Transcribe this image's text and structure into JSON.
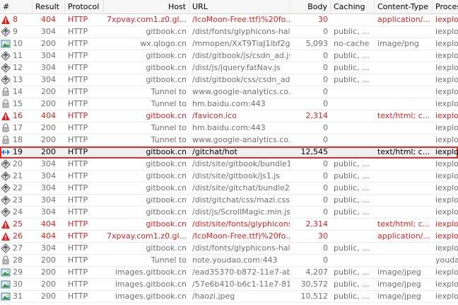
{
  "columns": [
    "#",
    "Result",
    "Protocol",
    "Host",
    "URL",
    "Body",
    "Caching",
    "Content-Type",
    "Process"
  ],
  "selected_row": 11,
  "colors": {
    "error": "#e02020",
    "muted": "#6f6f6f",
    "normal": "#000000",
    "selection_border": "#d83030"
  },
  "sessions": [
    {
      "num": "8",
      "result": "404",
      "protocol": "HTTP",
      "host": "7xpvay.com1.z0.gl...",
      "url": "/IcoMoon-Free.ttf)%20fo...",
      "body": "30",
      "caching": "",
      "content_type": "application/...",
      "process": "iexplor",
      "icon": "warning-icon",
      "style": "red"
    },
    {
      "num": "9",
      "result": "304",
      "protocol": "HTTP",
      "host": "gitbook.cn",
      "url": "/dist/fonts/glyphicons-half...",
      "body": "0",
      "caching": "public, ...",
      "content_type": "",
      "process": "iexplor",
      "icon": "diamond-arrows-icon",
      "style": "grey"
    },
    {
      "num": "10",
      "result": "200",
      "protocol": "HTTP",
      "host": "wx.qlogo.cn",
      "url": "/mmopen/XxT9TiaJ1ibf2gf...",
      "body": "5,093",
      "caching": "no-cache",
      "content_type": "image/png",
      "process": "iexplor",
      "icon": "image-icon",
      "style": "grey"
    },
    {
      "num": "11",
      "result": "304",
      "protocol": "HTTP",
      "host": "gitbook.cn",
      "url": "/dist/gitbook/js/csdn_ad.js",
      "body": "0",
      "caching": "public, ...",
      "content_type": "",
      "process": "iexplor",
      "icon": "diamond-arrows-icon",
      "style": "grey"
    },
    {
      "num": "12",
      "result": "304",
      "protocol": "HTTP",
      "host": "gitbook.cn",
      "url": "/dist/js/jquery.fatNav.js",
      "body": "0",
      "caching": "public, ...",
      "content_type": "",
      "process": "iexplor",
      "icon": "diamond-arrows-icon",
      "style": "grey"
    },
    {
      "num": "13",
      "result": "304",
      "protocol": "HTTP",
      "host": "gitbook.cn",
      "url": "/dist/gitbook/css/csdn_ad...",
      "body": "0",
      "caching": "public, ...",
      "content_type": "",
      "process": "iexplor",
      "icon": "diamond-arrows-icon",
      "style": "grey"
    },
    {
      "num": "14",
      "result": "200",
      "protocol": "HTTP",
      "host": "Tunnel to",
      "url": "www.google-analytics.co...",
      "body": "0",
      "caching": "",
      "content_type": "",
      "process": "iexplor",
      "icon": "lock-icon",
      "style": "grey"
    },
    {
      "num": "15",
      "result": "200",
      "protocol": "HTTP",
      "host": "Tunnel to",
      "url": "hm.baidu.com:443",
      "body": "0",
      "caching": "",
      "content_type": "",
      "process": "iexplor",
      "icon": "lock-icon",
      "style": "grey"
    },
    {
      "num": "16",
      "result": "404",
      "protocol": "HTTP",
      "host": "gitbook.cn",
      "url": "/favicon.ico",
      "body": "2,314",
      "caching": "",
      "content_type": "text/html; c...",
      "process": "iexplor",
      "icon": "warning-icon",
      "style": "red"
    },
    {
      "num": "17",
      "result": "200",
      "protocol": "HTTP",
      "host": "Tunnel to",
      "url": "hm.baidu.com:443",
      "body": "0",
      "caching": "",
      "content_type": "",
      "process": "iexplor",
      "icon": "lock-icon",
      "style": "grey"
    },
    {
      "num": "18",
      "result": "200",
      "protocol": "HTTP",
      "host": "Tunnel to",
      "url": "www.google-analytics.co...",
      "body": "0",
      "caching": "",
      "content_type": "",
      "process": "iexplor",
      "icon": "lock-icon",
      "style": "grey"
    },
    {
      "num": "19",
      "result": "200",
      "protocol": "HTTP",
      "host": "gitbook.cn",
      "url": "/gitchat/hot",
      "body": "12,545",
      "caching": "",
      "content_type": "text/html; c...",
      "process": "iexplo",
      "icon": "html-arrows-icon",
      "style": "blk"
    },
    {
      "num": "20",
      "result": "304",
      "protocol": "HTTP",
      "host": "gitbook.cn",
      "url": "/dist/site/gitbook/bundle1...",
      "body": "0",
      "caching": "public, ...",
      "content_type": "",
      "process": "iexplor",
      "icon": "diamond-arrows-icon",
      "style": "grey"
    },
    {
      "num": "21",
      "result": "304",
      "protocol": "HTTP",
      "host": "gitbook.cn",
      "url": "/dist/site/gitbook/js1.js",
      "body": "0",
      "caching": "public, ...",
      "content_type": "",
      "process": "iexplor",
      "icon": "diamond-arrows-icon",
      "style": "grey"
    },
    {
      "num": "22",
      "result": "304",
      "protocol": "HTTP",
      "host": "gitbook.cn",
      "url": "/dist/site/gitchat/bundle2....",
      "body": "0",
      "caching": "public, ...",
      "content_type": "",
      "process": "iexplor",
      "icon": "diamond-arrows-icon",
      "style": "grey"
    },
    {
      "num": "23",
      "result": "304",
      "protocol": "HTTP",
      "host": "gitbook.cn",
      "url": "/dist/gitchat/css/mazi.css",
      "body": "0",
      "caching": "public, ...",
      "content_type": "",
      "process": "iexplor",
      "icon": "diamond-arrows-icon",
      "style": "grey"
    },
    {
      "num": "24",
      "result": "304",
      "protocol": "HTTP",
      "host": "gitbook.cn",
      "url": "/dist/js/ScrollMagic.min.js",
      "body": "0",
      "caching": "public, ...",
      "content_type": "",
      "process": "iexplor",
      "icon": "diamond-arrows-icon",
      "style": "grey"
    },
    {
      "num": "25",
      "result": "404",
      "protocol": "HTTP",
      "host": "gitbook.cn",
      "url": "/dist/site/fonts/glyphicons...",
      "body": "2,314",
      "caching": "",
      "content_type": "text/html; c...",
      "process": "iexplor",
      "icon": "warning-icon",
      "style": "red"
    },
    {
      "num": "26",
      "result": "404",
      "protocol": "HTTP",
      "host": "7xpvay.com1.z0.gl...",
      "url": "/IcoMoon-Free.ttf)%20fo...",
      "body": "30",
      "caching": "",
      "content_type": "application/...",
      "process": "iexplor",
      "icon": "warning-icon",
      "style": "red"
    },
    {
      "num": "27",
      "result": "304",
      "protocol": "HTTP",
      "host": "gitbook.cn",
      "url": "/dist/fonts/glyphicons-half...",
      "body": "0",
      "caching": "public, ...",
      "content_type": "",
      "process": "iexplor",
      "icon": "diamond-arrows-icon",
      "style": "grey"
    },
    {
      "num": "28",
      "result": "200",
      "protocol": "HTTP",
      "host": "Tunnel to",
      "url": "note.youdao.com:443",
      "body": "0",
      "caching": "",
      "content_type": "",
      "process": "youdac",
      "icon": "lock-icon",
      "style": "grey"
    },
    {
      "num": "29",
      "result": "200",
      "protocol": "HTTP",
      "host": "images.gitbook.cn",
      "url": "/ead35370-b872-11e7-ab...",
      "body": "4,207",
      "caching": "public, ...",
      "content_type": "image/jpeg",
      "process": "iexplor",
      "icon": "image-icon",
      "style": "grey"
    },
    {
      "num": "30",
      "result": "200",
      "protocol": "HTTP",
      "host": "images.gitbook.cn",
      "url": "/57e6b410-b6c1-11e7-81...",
      "body": "30,572",
      "caching": "public, ...",
      "content_type": "image/jpeg",
      "process": "iexplor",
      "icon": "image-icon",
      "style": "grey"
    },
    {
      "num": "31",
      "result": "200",
      "protocol": "HTTP",
      "host": "images.gitbook.cn",
      "url": "/haozi.jpeg",
      "body": "10,512",
      "caching": "public, ...",
      "content_type": "image/jpeg",
      "process": "iexplor",
      "icon": "image-icon",
      "style": "grey"
    }
  ]
}
